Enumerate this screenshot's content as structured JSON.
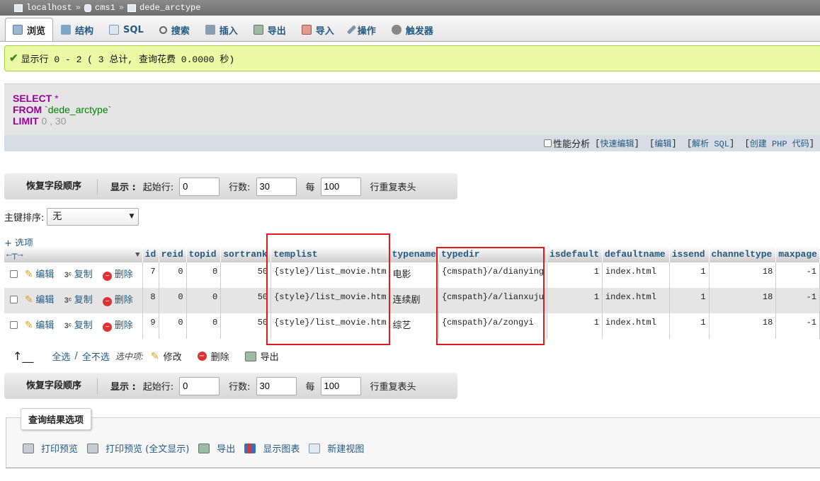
{
  "breadcrumb": [
    "localhost",
    "cms1",
    "dede_arctype"
  ],
  "tabs": [
    {
      "label": "浏览",
      "icon": "browse-icon",
      "active": true
    },
    {
      "label": "结构",
      "icon": "structure-icon"
    },
    {
      "label": "SQL",
      "icon": "sql-icon"
    },
    {
      "label": "搜索",
      "icon": "search-icon"
    },
    {
      "label": "插入",
      "icon": "insert-icon"
    },
    {
      "label": "导出",
      "icon": "export-icon"
    },
    {
      "label": "导入",
      "icon": "import-icon"
    },
    {
      "label": "操作",
      "icon": "wrench-icon"
    },
    {
      "label": "触发器",
      "icon": "trigger-icon"
    }
  ],
  "success": "显示行 0 - 2 ( 3 总计, 查询花费 0.0000 秒)",
  "sql": {
    "kw_select": "SELECT",
    "star": "*",
    "kw_from": "FROM",
    "table": "`dede_arctype`",
    "kw_limit": "LIMIT",
    "limit_start": "0",
    "comma": ",",
    "limit_count": "30"
  },
  "sql_links": {
    "profiling": "性能分析",
    "inline_edit": "快速编辑",
    "edit": "编辑",
    "explain": "解析 SQL",
    "create_php": "创建 PHP 代码"
  },
  "nav": {
    "restore": "恢复字段顺序",
    "show": "显示 :",
    "start_label": "起始行:",
    "start_value": "0",
    "rows_label": "行数:",
    "rows_value": "30",
    "every_label": "每",
    "every_value": "100",
    "repeat_label": "行重复表头"
  },
  "sort": {
    "label": "主键排序:",
    "value": "无"
  },
  "options_link": "+ 选项",
  "table": {
    "columns": [
      "id",
      "reid",
      "topid",
      "sortrank",
      "templist",
      "typename",
      "typedir",
      "isdefault",
      "defaultname",
      "issend",
      "channeltype",
      "maxpage"
    ],
    "actions": {
      "edit": "编辑",
      "copy": "复制",
      "delete": "删除"
    },
    "rows": [
      {
        "id": "7",
        "reid": "0",
        "topid": "0",
        "sortrank": "50",
        "templist": "{style}/list_movie.htm",
        "typename": "电影",
        "typedir": "{cmspath}/a/dianying",
        "isdefault": "1",
        "defaultname": "index.html",
        "issend": "1",
        "channeltype": "18",
        "maxpage": "-1"
      },
      {
        "id": "8",
        "reid": "0",
        "topid": "0",
        "sortrank": "50",
        "templist": "{style}/list_movie.htm",
        "typename": "连续剧",
        "typedir": "{cmspath}/a/lianxuju",
        "isdefault": "1",
        "defaultname": "index.html",
        "issend": "1",
        "channeltype": "18",
        "maxpage": "-1"
      },
      {
        "id": "9",
        "reid": "0",
        "topid": "0",
        "sortrank": "50",
        "templist": "{style}/list_movie.htm",
        "typename": "综艺",
        "typedir": "{cmspath}/a/zongyi",
        "isdefault": "1",
        "defaultname": "index.html",
        "issend": "1",
        "channeltype": "18",
        "maxpage": "-1"
      }
    ]
  },
  "bulk": {
    "check_all": "全选",
    "sep": "/",
    "uncheck_all": "全不选",
    "with_selected": "选中项:",
    "edit": "修改",
    "delete": "删除",
    "export": "导出"
  },
  "result_ops": {
    "title": "查询结果选项",
    "items": [
      "打印预览",
      "打印预览 (全文显示)",
      "导出",
      "显示图表",
      "新建视图"
    ]
  },
  "colors": {
    "link": "#235a81",
    "success_bg": "#ebf8a4",
    "highlight": "#e01b1b",
    "keyword": "#990099"
  }
}
